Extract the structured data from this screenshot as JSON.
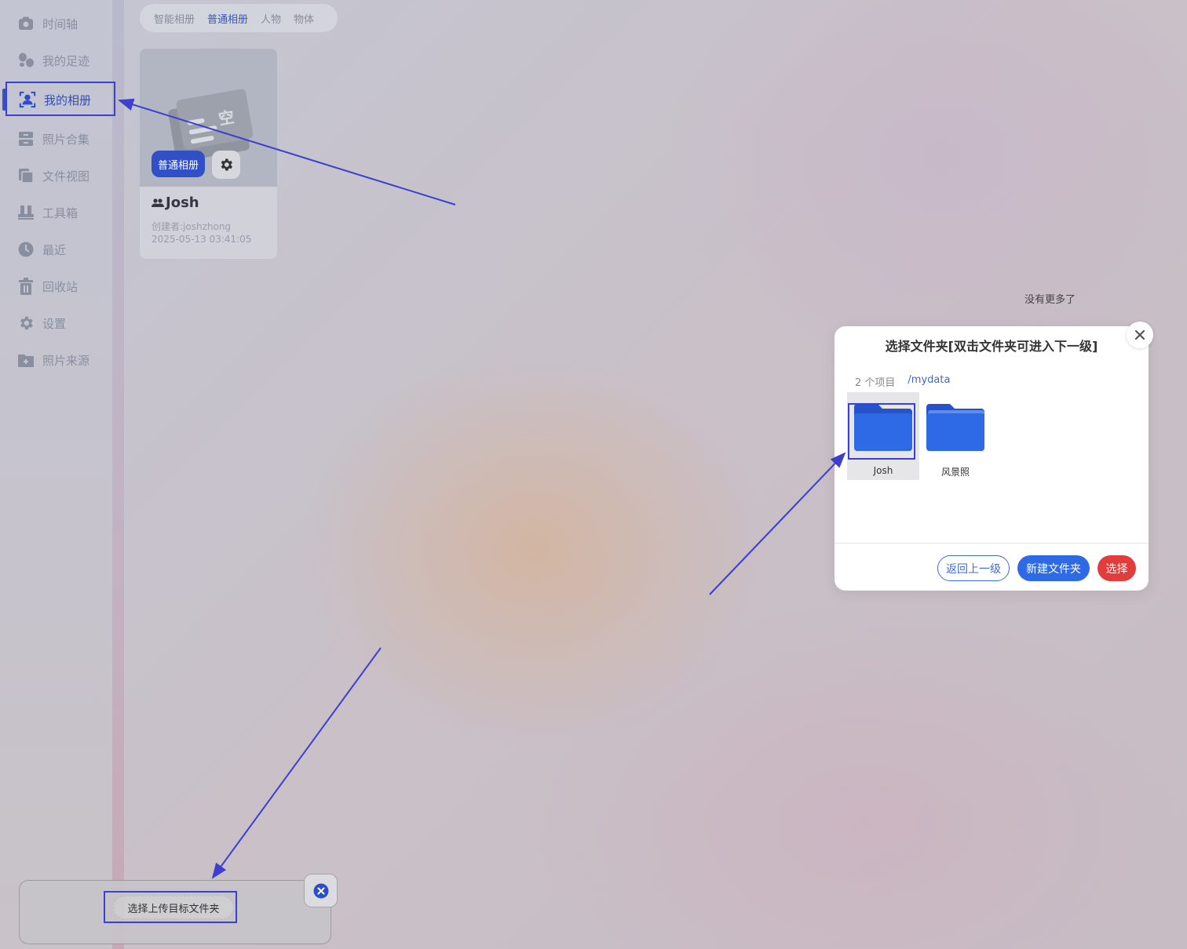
{
  "sidebar": {
    "items": [
      {
        "label": "时间轴",
        "icon": "timeline-icon"
      },
      {
        "label": "我的足迹",
        "icon": "footprints-icon"
      },
      {
        "label": "我的相册",
        "icon": "portrait-icon",
        "active": true
      },
      {
        "label": "照片合集",
        "icon": "collection-icon"
      },
      {
        "label": "文件视图",
        "icon": "files-icon"
      },
      {
        "label": "工具箱",
        "icon": "toolbox-icon"
      },
      {
        "label": "最近",
        "icon": "clock-icon"
      },
      {
        "label": "回收站",
        "icon": "trash-icon"
      },
      {
        "label": "设置",
        "icon": "gear-icon"
      },
      {
        "label": "照片来源",
        "icon": "folder-add-icon"
      }
    ]
  },
  "tabs": [
    {
      "label": "智能相册"
    },
    {
      "label": "普通相册",
      "active": true
    },
    {
      "label": "人物"
    },
    {
      "label": "物体"
    }
  ],
  "album": {
    "badge": "普通相册",
    "title": "Josh",
    "creator": "创建者:joshzhong",
    "date": "2025-05-13 03:41:05",
    "cover_text": "空"
  },
  "no_more": "没有更多了",
  "dialog": {
    "title": "选择文件夹[双击文件夹可进入下一级]",
    "count": "2 个项目",
    "path": "/mydata",
    "folders": [
      {
        "label": "Josh",
        "selected": true
      },
      {
        "label": "风景照"
      }
    ],
    "buttons": {
      "back": "返回上一级",
      "new_folder": "新建文件夹",
      "select": "选择"
    }
  },
  "upload": {
    "button": "选择上传目标文件夹"
  },
  "colors": {
    "accent": "#3150c7",
    "folder": "#2f6ae6",
    "danger": "#e23d3d",
    "annotation": "#3d3fd0"
  }
}
